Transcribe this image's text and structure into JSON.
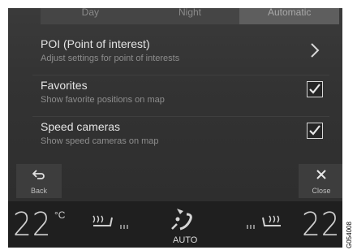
{
  "modes": [
    {
      "label": "Day",
      "active": false
    },
    {
      "label": "Night",
      "active": false
    },
    {
      "label": "Automatic",
      "active": true
    }
  ],
  "settings": [
    {
      "title": "POI (Point of interest)",
      "subtitle": "Adjust settings for point of interests",
      "control": "chevron-right-icon"
    },
    {
      "title": "Favorites",
      "subtitle": "Show favorite positions on map",
      "control": "checkbox",
      "checked": true
    },
    {
      "title": "Speed cameras",
      "subtitle": "Show speed cameras on map",
      "control": "checkbox",
      "checked": true
    }
  ],
  "actions": {
    "back_label": "Back",
    "close_label": "Close"
  },
  "climate": {
    "left_temp": "22",
    "left_unit": "°C",
    "right_temp": "22",
    "fan_mode": "AUTO",
    "icons": [
      "seat-heat-left-icon",
      "fan-auto-icon",
      "seat-heat-right-icon"
    ]
  },
  "watermark": "G054008",
  "colors": {
    "background": "#2b2b2b",
    "text": "#e4e4e4",
    "subtext": "#8d8d8d",
    "active_tab": "#5e5e5e"
  }
}
